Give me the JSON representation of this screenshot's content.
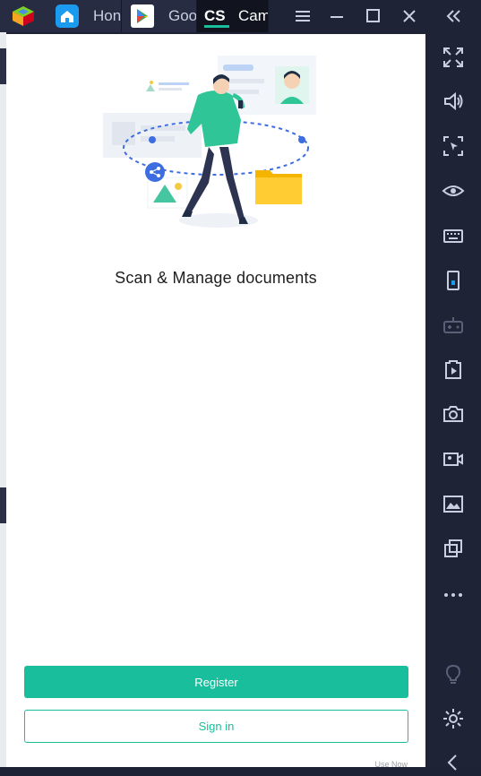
{
  "titlebar": {
    "tabs": [
      {
        "label": "Hon",
        "icon": "home-icon",
        "active": false
      },
      {
        "label": "Goo",
        "icon": "google-play-icon",
        "active": false
      },
      {
        "label": "Cam",
        "icon": "camscanner-icon",
        "active": true,
        "icon_text": "CS"
      }
    ],
    "app_icon": "bluestacks-logo-icon",
    "controls": [
      "hamburger-menu-icon",
      "minimize-icon",
      "maximize-icon",
      "close-icon",
      "collapse-sidebar-icon"
    ]
  },
  "screen": {
    "headline": "Scan & Manage documents",
    "register_label": "Register",
    "signin_label": "Sign in",
    "footer_hint": "Use Now"
  },
  "sidebar": {
    "buttons": [
      "fullscreen-icon",
      "volume-icon",
      "cursor-select-icon",
      "eye-icon",
      "keyboard-icon",
      "phone-rotate-icon",
      "gamepad-icon",
      "install-apk-icon",
      "screenshot-icon",
      "record-video-icon",
      "media-folder-icon",
      "multi-instance-icon",
      "more-icon",
      "eco-mode-icon",
      "settings-icon",
      "back-icon"
    ]
  },
  "colors": {
    "accent": "#19bf9c",
    "chrome": "#1f2336",
    "folder": "#ffcc33",
    "person_shirt": "#2fc597"
  }
}
